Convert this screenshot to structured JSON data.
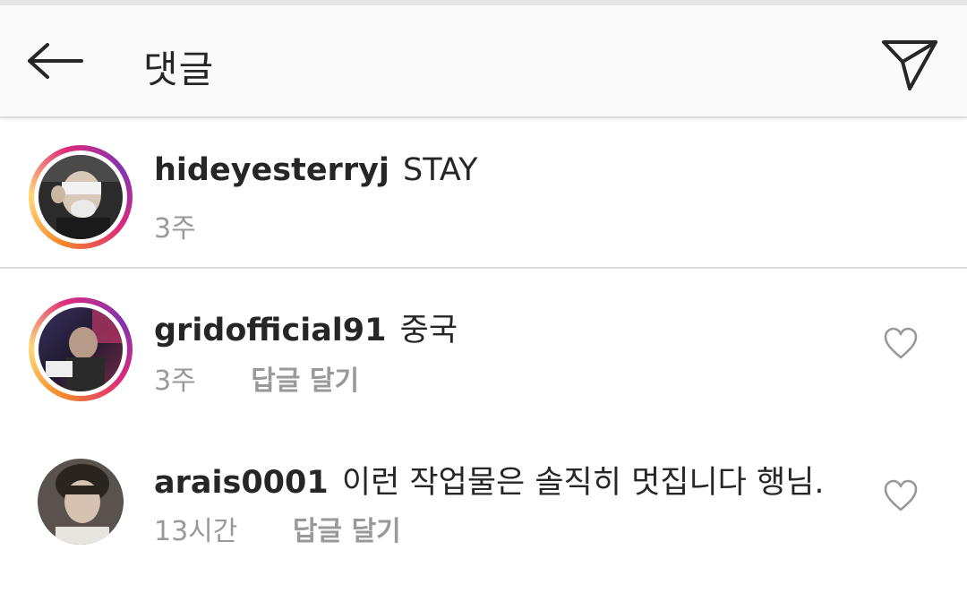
{
  "header": {
    "title": "댓글",
    "back_icon": "arrow-left-icon",
    "share_icon": "paper-plane-icon"
  },
  "comments": [
    {
      "username": "hideyesterryj",
      "text": "STAY",
      "time": "3주",
      "reply_label": "",
      "has_story_ring": true,
      "liked": false
    },
    {
      "username": "gridofficial91",
      "text": "중국",
      "time": "3주",
      "reply_label": "답글 달기",
      "has_story_ring": true,
      "liked": false
    },
    {
      "username": "arais0001",
      "text": "이런 작업물은 솔직히 멋집니다 행님.",
      "time": "13시간",
      "reply_label": "답글 달기",
      "has_story_ring": false,
      "liked": false
    }
  ],
  "colors": {
    "text": "#262626",
    "secondary": "#999999",
    "divider": "#dbdbdb",
    "ring_start": "#f58529",
    "ring_end": "#dd2a7b"
  }
}
